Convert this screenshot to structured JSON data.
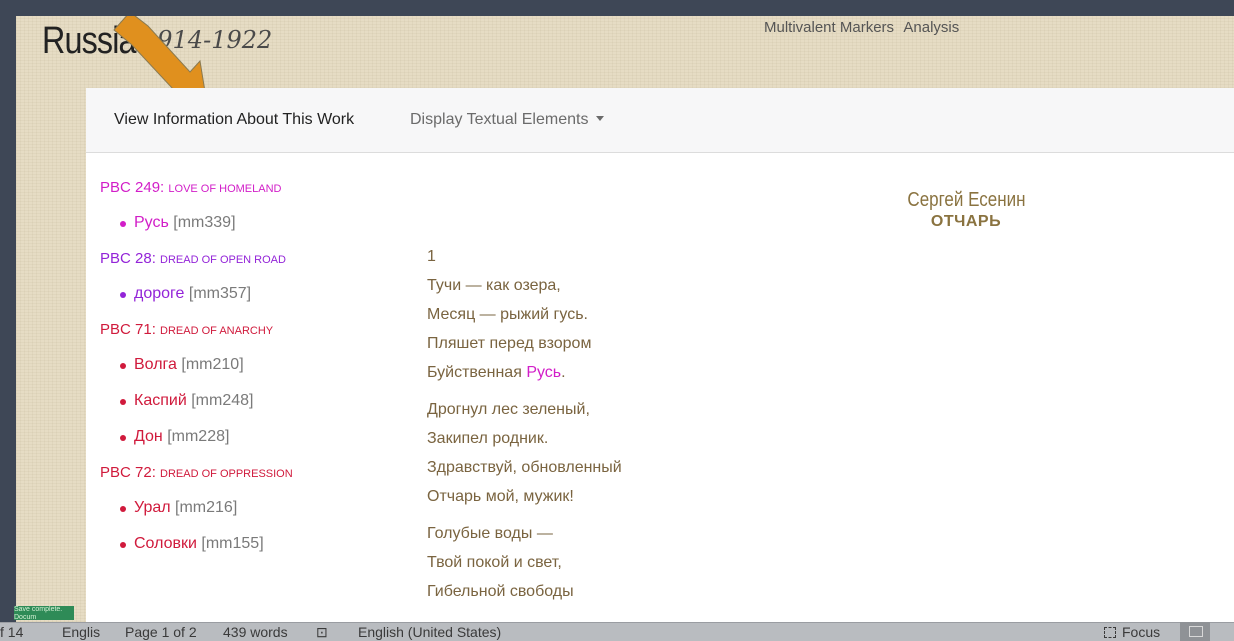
{
  "header": {
    "title": "Russia",
    "years": "1914-1922",
    "links": [
      "Multivalent Markers",
      "Analysis"
    ]
  },
  "nav": {
    "info_label": "View Information About This Work",
    "display_label": "Display Textual Elements"
  },
  "markers": [
    {
      "code": "PBC 249:",
      "name": "Love of homeland",
      "color": "#d21ec8",
      "items": [
        {
          "word": "Русь",
          "ref": "[mm339]"
        }
      ]
    },
    {
      "code": "PBC 28:",
      "name": "Dread of open road",
      "color": "#9324d8",
      "items": [
        {
          "word": "дороге",
          "ref": "[mm357]"
        }
      ]
    },
    {
      "code": "PBC 71:",
      "name": "Dread of anarchy",
      "color": "#d01a3c",
      "items": [
        {
          "word": "Волга",
          "ref": "[mm210]"
        },
        {
          "word": "Каспий",
          "ref": "[mm248]"
        },
        {
          "word": "Дон",
          "ref": "[mm228]"
        }
      ]
    },
    {
      "code": "PBC 72:",
      "name": "Dread of oppression",
      "color": "#d01a3c",
      "items": [
        {
          "word": "Урал",
          "ref": "[mm216]"
        },
        {
          "word": "Соловки",
          "ref": "[mm155]"
        }
      ]
    }
  ],
  "poem": {
    "section": "1",
    "stanzas": [
      [
        "Тучи — как озера,",
        "Месяц — рыжий гусь.",
        "Пляшет перед взором",
        "Буйственная Русь."
      ],
      [
        "Дрогнул лес зеленый,",
        "Закипел родник.",
        "Здравствуй, обновленный",
        "Отчарь мой, мужик!"
      ],
      [
        "Голубые воды —",
        "Твой покой и свет,",
        "Гибельной свободы"
      ]
    ],
    "highlight": {
      "word": "Русь",
      "color": "#d21ec8"
    }
  },
  "author": {
    "name": "Сергей Есенин",
    "work_title": "ОТЧАРЬ"
  },
  "statusbar": {
    "page_count": "f 14",
    "language_short": "Englis",
    "page": "Page 1 of 2",
    "words": "439 words",
    "language": "English (United States)",
    "focus": "Focus",
    "save_note": "Save complete. Docum"
  },
  "colors": {
    "arrow": "#e0901e",
    "page_bg": "#e6dcc4",
    "poem_text": "#7a6440"
  }
}
